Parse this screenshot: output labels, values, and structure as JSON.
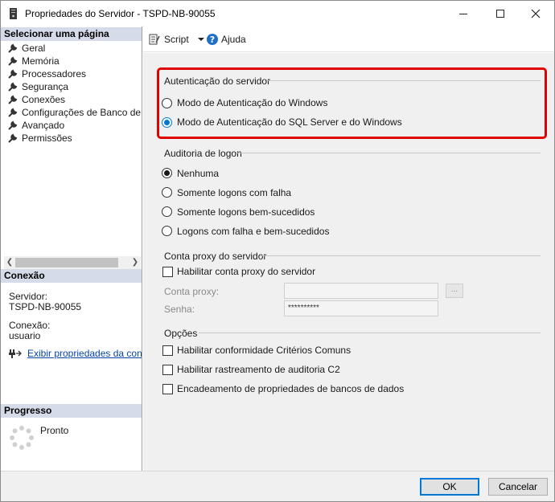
{
  "window": {
    "title": "Propriedades do Servidor - TSPD-NB-90055",
    "minimize_glyph": "—",
    "maximize_glyph": "☐",
    "close_glyph": "✕"
  },
  "left": {
    "select_page_header": "Selecionar uma página",
    "pages": [
      {
        "label": "Geral",
        "icon": "wrench-icon"
      },
      {
        "label": "Memória",
        "icon": "wrench-icon"
      },
      {
        "label": "Processadores",
        "icon": "wrench-icon"
      },
      {
        "label": "Segurança",
        "icon": "wrench-icon"
      },
      {
        "label": "Conexões",
        "icon": "wrench-icon"
      },
      {
        "label": "Configurações de Banco de Da",
        "icon": "wrench-icon"
      },
      {
        "label": "Avançado",
        "icon": "wrench-icon"
      },
      {
        "label": "Permissões",
        "icon": "wrench-icon"
      }
    ],
    "connection_header": "Conexão",
    "server_label": "Servidor:",
    "server_value": "TSPD-NB-90055",
    "connection_label": "Conexão:",
    "connection_value": "usuario",
    "view_connection_link": "Exibir propriedades da conexã",
    "progress_header": "Progresso",
    "progress_status": "Pronto"
  },
  "toolbar": {
    "script_label": "Script",
    "help_label": "Ajuda"
  },
  "auth": {
    "group_label": "Autenticação do servidor",
    "windows_mode": "Modo de Autenticação do Windows",
    "mixed_mode": "Modo de Autenticação do SQL Server e do Windows",
    "selected": "mixed_mode"
  },
  "audit": {
    "group_label": "Auditoria de logon",
    "options": [
      "Nenhuma",
      "Somente logons com falha",
      "Somente logons bem-sucedidos",
      "Logons com falha e bem-sucedidos"
    ],
    "selected_index": 0
  },
  "proxy": {
    "group_label": "Conta proxy do servidor",
    "enable_label": "Habilitar conta proxy do servidor",
    "enabled": false,
    "account_label": "Conta proxy:",
    "account_value": "",
    "password_label": "Senha:",
    "password_value": "**********",
    "browse_label": "..."
  },
  "options": {
    "group_label": "Opções",
    "items": [
      {
        "label": "Habilitar conformidade Critérios Comuns",
        "checked": false
      },
      {
        "label": "Habilitar rastreamento de auditoria C2",
        "checked": false
      },
      {
        "label": "Encadeamento de propriedades de bancos de dados",
        "checked": false
      }
    ]
  },
  "footer": {
    "ok_label": "OK",
    "cancel_label": "Cancelar"
  },
  "colors": {
    "accent": "#0078d7",
    "highlight_border": "#e00000",
    "header_bg": "#d6dbe9",
    "link": "#0645ad"
  }
}
